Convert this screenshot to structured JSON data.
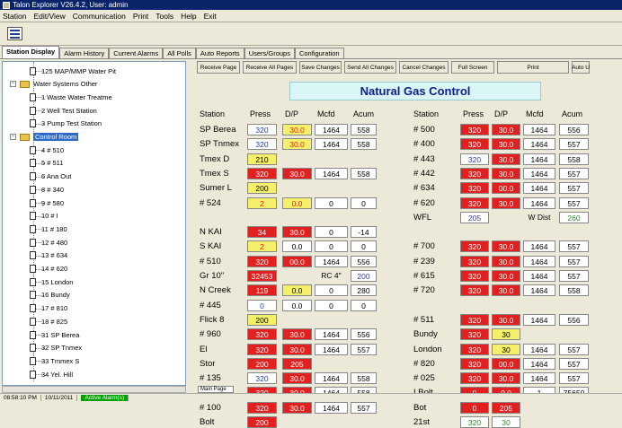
{
  "window": {
    "title": "Talon Explorer V26.4.2, User: admin"
  },
  "menu": [
    "Station",
    "Edit/View",
    "Communication",
    "Print",
    "Tools",
    "Help",
    "Exit"
  ],
  "tabs": [
    "Station Display",
    "Alarm History",
    "Current Alarms",
    "All Polls",
    "Auto Reports",
    "Users/Groups",
    "Configuration"
  ],
  "tree": [
    {
      "label": "125 MAP/MMP Water Pit",
      "kind": "leaf"
    },
    {
      "label": "Water Systems Other",
      "kind": "folder"
    },
    {
      "label": "1 Waste Water Treatme",
      "kind": "leaf"
    },
    {
      "label": "2 Well Test Station",
      "kind": "leaf"
    },
    {
      "label": "3 Pump Test Station",
      "kind": "leaf"
    },
    {
      "label": "Control Room",
      "kind": "folder",
      "selected": true
    },
    {
      "label": "4 # 510",
      "kind": "leaf"
    },
    {
      "label": "5 # 511",
      "kind": "leaf"
    },
    {
      "label": "6 Ana Out",
      "kind": "leaf"
    },
    {
      "label": "8 # 340",
      "kind": "leaf"
    },
    {
      "label": "9 # 580",
      "kind": "leaf"
    },
    {
      "label": "10 # I",
      "kind": "leaf"
    },
    {
      "label": "11 # 180",
      "kind": "leaf"
    },
    {
      "label": "12 # 480",
      "kind": "leaf"
    },
    {
      "label": "13 # 634",
      "kind": "leaf"
    },
    {
      "label": "14 # 620",
      "kind": "leaf"
    },
    {
      "label": "15 London",
      "kind": "leaf"
    },
    {
      "label": "16 Bundy",
      "kind": "leaf"
    },
    {
      "label": "17 # 810",
      "kind": "leaf"
    },
    {
      "label": "18 # 825",
      "kind": "leaf"
    },
    {
      "label": "31 SP Berea",
      "kind": "leaf"
    },
    {
      "label": "32 SP Tnmex",
      "kind": "leaf"
    },
    {
      "label": "33 Tmmex S",
      "kind": "leaf"
    },
    {
      "label": "34 Yel. Hill",
      "kind": "leaf"
    }
  ],
  "buttons": [
    "Receive Page",
    "Receive All Pages",
    "Save Changes",
    "Send All Changes",
    "Cancel Changes",
    "Full Screen",
    "Print",
    "Auto U"
  ],
  "panel": {
    "title": "Natural Gas Control",
    "left_headers": [
      "Station",
      "Press",
      "D/P",
      "Mcfd",
      "Acum"
    ],
    "right_headers": [
      "Station",
      "Press",
      "D/P",
      "Mcfd",
      "Acum"
    ],
    "left_rows": [
      {
        "label": "SP Berea",
        "cells": [
          [
            "320",
            "wb"
          ],
          [
            "30.0",
            "yr"
          ],
          [
            "1464",
            "w"
          ],
          [
            "558",
            "w"
          ]
        ]
      },
      {
        "label": "SP Tnmex",
        "cells": [
          [
            "320",
            "wb"
          ],
          [
            "30.0",
            "yr"
          ],
          [
            "1464",
            "w"
          ],
          [
            "558",
            "w"
          ]
        ]
      },
      {
        "label": "Tmex D",
        "cells": [
          [
            "210",
            "y"
          ]
        ]
      },
      {
        "label": "Tmex S",
        "cells": [
          [
            "320",
            "r"
          ],
          [
            "30.0",
            "r"
          ],
          [
            "1464",
            "w"
          ],
          [
            "558",
            "w"
          ]
        ]
      },
      {
        "label": "Sumer L",
        "cells": [
          [
            "200",
            "y"
          ]
        ]
      },
      {
        "label": "# 524",
        "cells": [
          [
            "2",
            "yr"
          ],
          [
            "0.0",
            "yr"
          ],
          [
            "0",
            "w"
          ],
          [
            "0",
            "w"
          ]
        ]
      },
      {
        "label": "",
        "cells": []
      },
      {
        "label": "N KAI",
        "cells": [
          [
            "34",
            "r"
          ],
          [
            "30.0",
            "r"
          ],
          [
            "0",
            "w"
          ],
          [
            "-14",
            "w"
          ]
        ]
      },
      {
        "label": "S KAI",
        "cells": [
          [
            "2",
            "yr"
          ],
          [
            "0.0",
            "w"
          ],
          [
            "0",
            "w"
          ],
          [
            "0",
            "w"
          ]
        ]
      },
      {
        "label": "# 510",
        "cells": [
          [
            "320",
            "r"
          ],
          [
            "00.0",
            "r"
          ],
          [
            "1464",
            "w"
          ],
          [
            "556",
            "w"
          ]
        ]
      },
      {
        "label": "Gr 10\"",
        "cells": [
          [
            "32453",
            "r"
          ],
          [
            "",
            "g"
          ],
          [
            "RC 4\"",
            "g"
          ],
          [
            "200",
            "wb"
          ]
        ]
      },
      {
        "label": "N Creek",
        "cells": [
          [
            "119",
            "r"
          ],
          [
            "0.0",
            "y"
          ],
          [
            "0",
            "w"
          ],
          [
            "280",
            "w"
          ]
        ]
      },
      {
        "label": "# 445",
        "cells": [
          [
            "0",
            "wb"
          ],
          [
            "0.0",
            "w"
          ],
          [
            "0",
            "w"
          ],
          [
            "0",
            "w"
          ]
        ]
      },
      {
        "label": "Flick 8",
        "cells": [
          [
            "200",
            "y"
          ]
        ]
      },
      {
        "label": "# 960",
        "cells": [
          [
            "320",
            "r"
          ],
          [
            "30.0",
            "r"
          ],
          [
            "1464",
            "w"
          ],
          [
            "556",
            "w"
          ]
        ]
      },
      {
        "label": "El",
        "cells": [
          [
            "320",
            "r"
          ],
          [
            "30.0",
            "r"
          ],
          [
            "1464",
            "w"
          ],
          [
            "557",
            "w"
          ]
        ]
      },
      {
        "label": "Stor",
        "cells": [
          [
            "200",
            "r"
          ],
          [
            "205",
            "r"
          ]
        ]
      },
      {
        "label": "# 135",
        "cells": [
          [
            "320",
            "wb"
          ],
          [
            "30.0",
            "r"
          ],
          [
            "1464",
            "w"
          ],
          [
            "558",
            "w"
          ]
        ]
      },
      {
        "label": "Yel Hill",
        "cells": [
          [
            "320",
            "r"
          ],
          [
            "30.0",
            "r"
          ],
          [
            "1464",
            "w"
          ],
          [
            "558",
            "w"
          ]
        ]
      },
      {
        "label": "# 100",
        "cells": [
          [
            "320",
            "r"
          ],
          [
            "30.0",
            "r"
          ],
          [
            "1464",
            "w"
          ],
          [
            "557",
            "w"
          ]
        ]
      },
      {
        "label": "Bolt",
        "cells": [
          [
            "200",
            "r"
          ]
        ]
      }
    ],
    "right_rows": [
      {
        "label": "# 500",
        "cells": [
          [
            "320",
            "r"
          ],
          [
            "30.0",
            "r"
          ],
          [
            "1464",
            "w"
          ],
          [
            "556",
            "w"
          ]
        ]
      },
      {
        "label": "# 400",
        "cells": [
          [
            "320",
            "r"
          ],
          [
            "30.0",
            "r"
          ],
          [
            "1464",
            "w"
          ],
          [
            "557",
            "w"
          ]
        ]
      },
      {
        "label": "# 443",
        "cells": [
          [
            "320",
            "wb"
          ],
          [
            "30.0",
            "r"
          ],
          [
            "1464",
            "w"
          ],
          [
            "558",
            "w"
          ]
        ]
      },
      {
        "label": "# 442",
        "cells": [
          [
            "320",
            "r"
          ],
          [
            "30.0",
            "r"
          ],
          [
            "1464",
            "w"
          ],
          [
            "557",
            "w"
          ]
        ]
      },
      {
        "label": "# 634",
        "cells": [
          [
            "320",
            "r"
          ],
          [
            "00.0",
            "r"
          ],
          [
            "1464",
            "w"
          ],
          [
            "557",
            "w"
          ]
        ]
      },
      {
        "label": "# 620",
        "cells": [
          [
            "320",
            "r"
          ],
          [
            "30.0",
            "r"
          ],
          [
            "1464",
            "w"
          ],
          [
            "557",
            "w"
          ]
        ]
      },
      {
        "label": "WFL",
        "cells": [
          [
            "205",
            "wb"
          ],
          [
            "",
            "g"
          ],
          [
            "W Dist",
            "g"
          ],
          [
            "260",
            "wg"
          ]
        ]
      },
      {
        "label": "",
        "cells": []
      },
      {
        "label": "# 700",
        "cells": [
          [
            "320",
            "r"
          ],
          [
            "30.0",
            "r"
          ],
          [
            "1464",
            "w"
          ],
          [
            "557",
            "w"
          ]
        ]
      },
      {
        "label": "# 239",
        "cells": [
          [
            "320",
            "r"
          ],
          [
            "30.0",
            "r"
          ],
          [
            "1464",
            "w"
          ],
          [
            "557",
            "w"
          ]
        ]
      },
      {
        "label": "# 615",
        "cells": [
          [
            "320",
            "r"
          ],
          [
            "30.0",
            "r"
          ],
          [
            "1464",
            "w"
          ],
          [
            "557",
            "w"
          ]
        ]
      },
      {
        "label": "# 720",
        "cells": [
          [
            "320",
            "r"
          ],
          [
            "30.0",
            "r"
          ],
          [
            "1464",
            "w"
          ],
          [
            "558",
            "w"
          ]
        ]
      },
      {
        "label": "",
        "cells": []
      },
      {
        "label": "# 511",
        "cells": [
          [
            "320",
            "r"
          ],
          [
            "30.0",
            "r"
          ],
          [
            "1464",
            "w"
          ],
          [
            "556",
            "w"
          ]
        ]
      },
      {
        "label": "Bundy",
        "cells": [
          [
            "320",
            "r"
          ],
          [
            "30",
            "y"
          ]
        ]
      },
      {
        "label": "London",
        "cells": [
          [
            "320",
            "r"
          ],
          [
            "30",
            "y"
          ],
          [
            "1464",
            "w"
          ],
          [
            "557",
            "w"
          ]
        ]
      },
      {
        "label": "# 820",
        "cells": [
          [
            "320",
            "r"
          ],
          [
            "00.0",
            "r"
          ],
          [
            "1464",
            "w"
          ],
          [
            "557",
            "w"
          ]
        ]
      },
      {
        "label": "# 025",
        "cells": [
          [
            "320",
            "r"
          ],
          [
            "30.0",
            "r"
          ],
          [
            "1464",
            "w"
          ],
          [
            "557",
            "w"
          ]
        ]
      },
      {
        "label": "I Bolt",
        "cells": [
          [
            "0",
            "r"
          ],
          [
            "0.0",
            "r"
          ],
          [
            "1",
            "w"
          ],
          [
            "75650",
            "w"
          ]
        ]
      },
      {
        "label": "Bot",
        "cells": [
          [
            "0",
            "r"
          ],
          [
            "205",
            "r"
          ]
        ]
      },
      {
        "label": "21st",
        "cells": [
          [
            "320",
            "wg"
          ],
          [
            "30",
            "wg"
          ]
        ]
      }
    ]
  },
  "bottom_tab": "Main Page",
  "status": {
    "time": "08:58:10 PM",
    "date": "10/11/2011",
    "alarm": "Active Alarm(s)"
  }
}
